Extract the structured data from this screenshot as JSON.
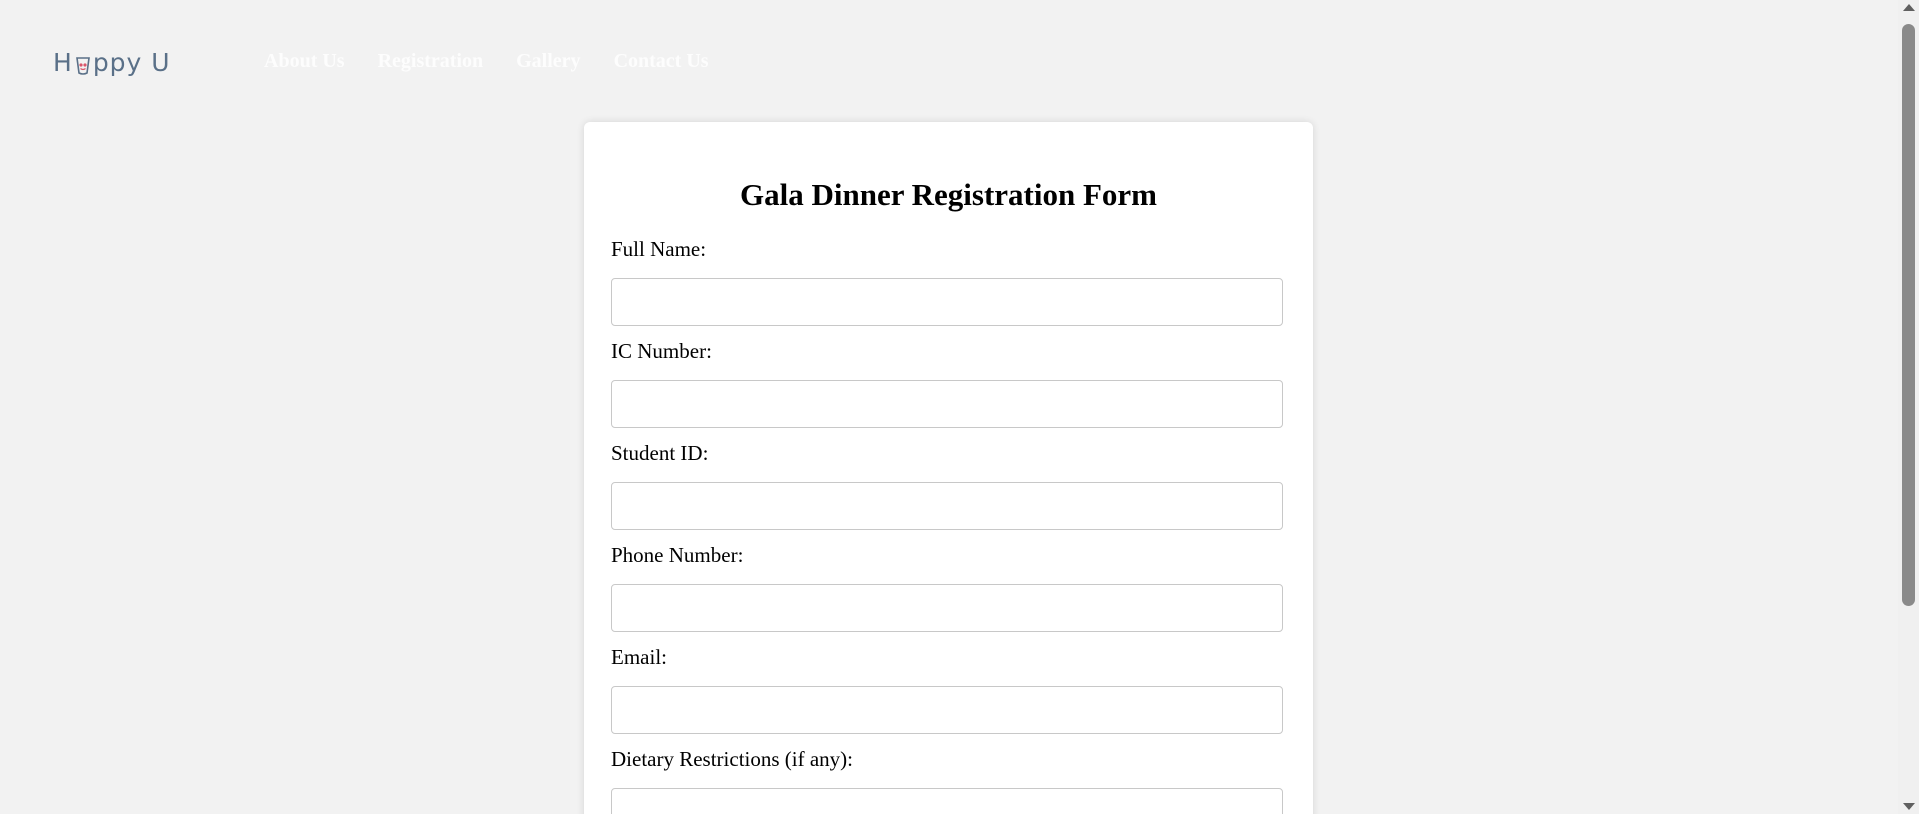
{
  "header": {
    "logo_text_left": "H",
    "logo_text_right": "ppy U",
    "nav": [
      {
        "label": "About Us"
      },
      {
        "label": "Registration"
      },
      {
        "label": "Gallery"
      },
      {
        "label": "Contact Us"
      }
    ]
  },
  "form": {
    "title": "Gala Dinner Registration Form",
    "fields": [
      {
        "label": "Full Name:",
        "value": "",
        "placeholder": ""
      },
      {
        "label": "IC Number:",
        "value": "",
        "placeholder": ""
      },
      {
        "label": "Student ID:",
        "value": "",
        "placeholder": ""
      },
      {
        "label": "Phone Number:",
        "value": "",
        "placeholder": ""
      },
      {
        "label": "Email:",
        "value": "",
        "placeholder": ""
      },
      {
        "label": "Dietary Restrictions (if any):",
        "value": "",
        "placeholder": ""
      }
    ]
  },
  "colors": {
    "background": "#f2f2f2",
    "card": "#ffffff",
    "logo": "#5a7088",
    "logo_accent": "#d9566b",
    "nav_text": "#ffffff"
  },
  "icons": {
    "logo_mark": "cup-icon",
    "scroll_up": "triangle-up-icon",
    "scroll_down": "triangle-down-icon"
  }
}
